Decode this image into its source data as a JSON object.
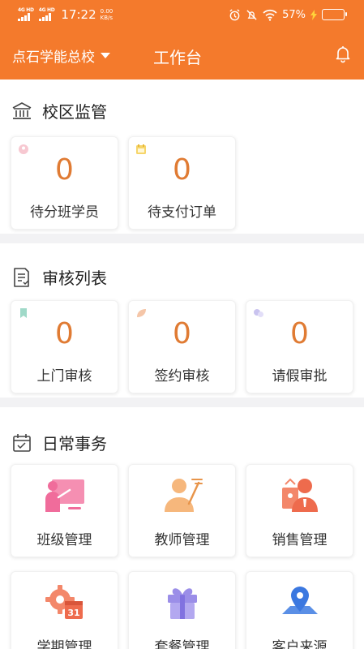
{
  "status_bar": {
    "network_1": "4G HD",
    "network_2": "4G HD",
    "time": "17:22",
    "net_speed_value": "0.00",
    "net_speed_unit": "KB/s",
    "battery_text": "57%",
    "battery_level": 0.57
  },
  "header": {
    "campus_name": "点石学能总校",
    "title": "工作台"
  },
  "sections": {
    "campus": {
      "title": "校区监管",
      "cards": [
        {
          "value": "0",
          "label": "待分班学员",
          "icon": "user-icon"
        },
        {
          "value": "0",
          "label": "待支付订单",
          "icon": "calendar-icon"
        }
      ]
    },
    "review": {
      "title": "审核列表",
      "cards": [
        {
          "value": "0",
          "label": "上门审核",
          "icon": "bookmark-icon"
        },
        {
          "value": "0",
          "label": "签约审核",
          "icon": "leaf-icon"
        },
        {
          "value": "0",
          "label": "请假审批",
          "icon": "people-icon"
        }
      ]
    },
    "daily": {
      "title": "日常事务",
      "tiles": [
        {
          "label": "班级管理",
          "icon": "classroom-icon"
        },
        {
          "label": "教师管理",
          "icon": "teacher-icon"
        },
        {
          "label": "销售管理",
          "icon": "sales-icon"
        },
        {
          "label": "学期管理",
          "icon": "semester-icon",
          "icon_text": "31"
        },
        {
          "label": "套餐管理",
          "icon": "gift-icon"
        },
        {
          "label": "客户来源",
          "icon": "location-pin-icon"
        }
      ]
    }
  },
  "colors": {
    "brand": "#f47a2c",
    "number": "#e07b33",
    "background": "#f2f2f4"
  }
}
